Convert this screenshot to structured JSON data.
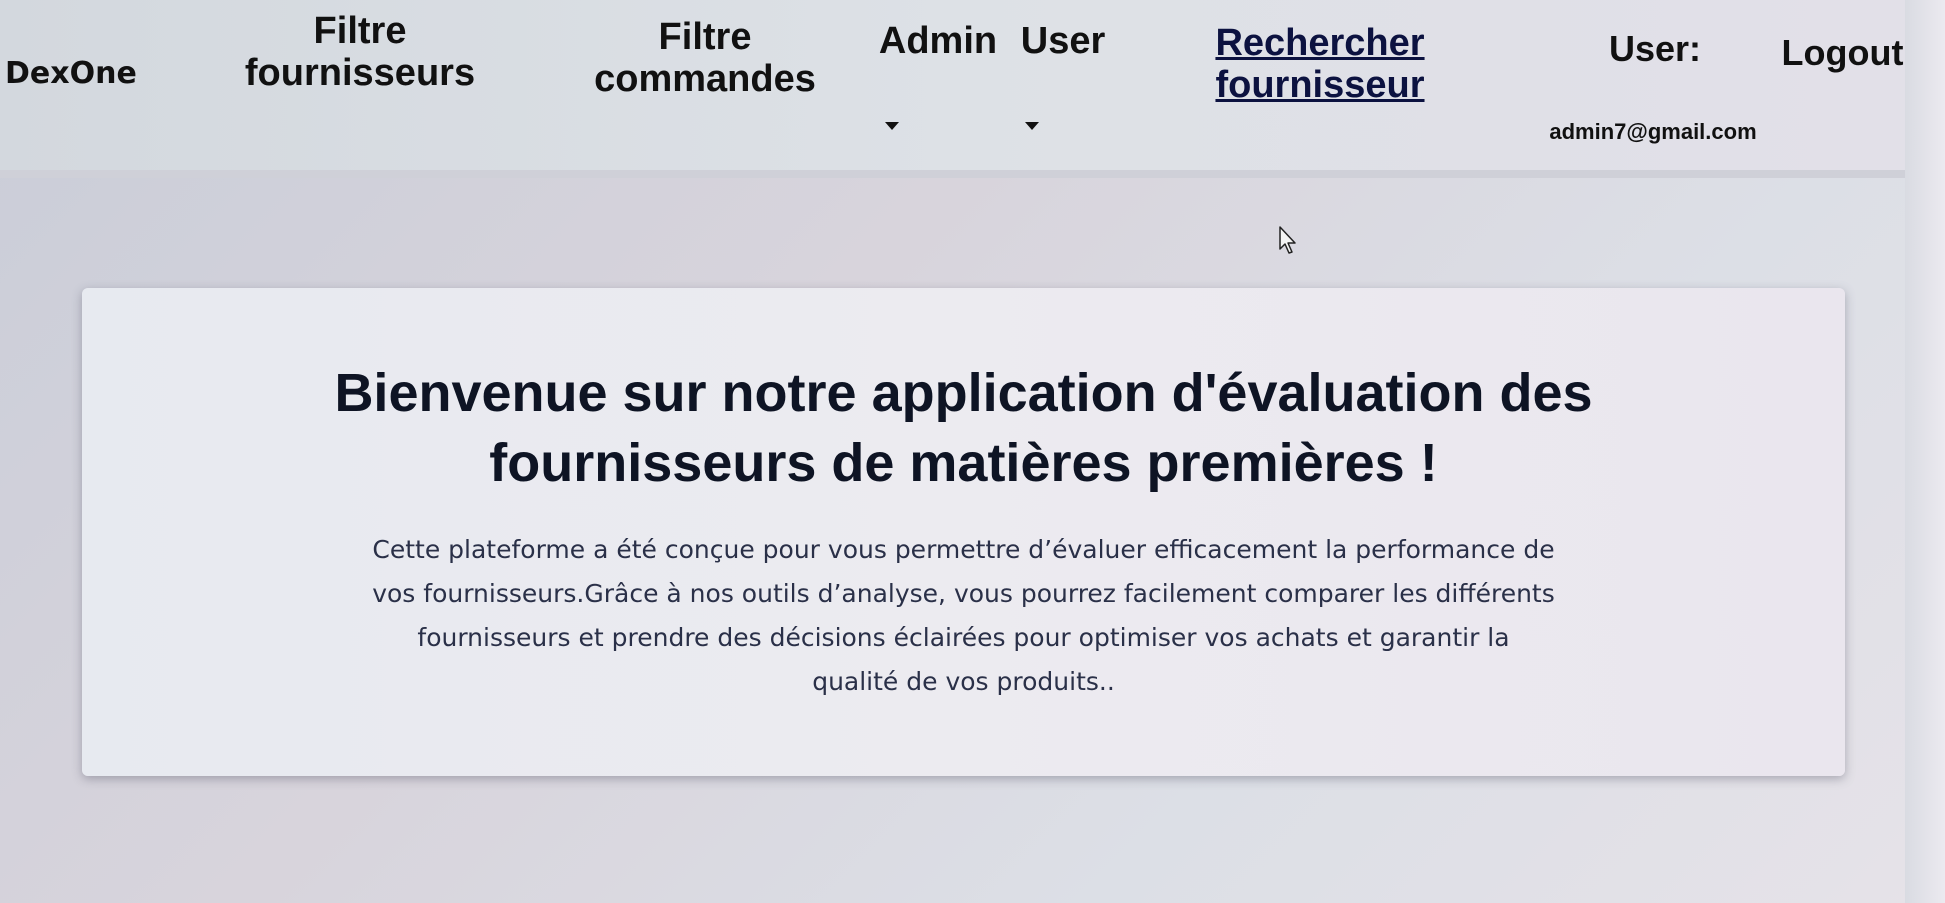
{
  "navbar": {
    "brand": "DexOne",
    "filtre_fournisseurs": "Filtre\nfournisseurs",
    "filtre_commandes": "Filtre\ncommandes",
    "admin_menu": "Admin",
    "user_menu": "User",
    "rechercher_fournisseur": "Rechercher\nfournisseur",
    "user_label": "User:",
    "user_email": "admin7@gmail.com",
    "logout": "Logout"
  },
  "welcome": {
    "title": "Bienvenue sur notre application d'évaluation des fournisseurs de matières premières !",
    "text": "Cette plateforme a été conçue pour vous permettre d’évaluer efficacement la performance de vos fournisseurs.Grâce à nos outils d’analyse, vous pourrez facilement comparer les différents fournisseurs et prendre des décisions éclairées pour optimiser vos achats et garantir la qualité de vos produits.."
  }
}
